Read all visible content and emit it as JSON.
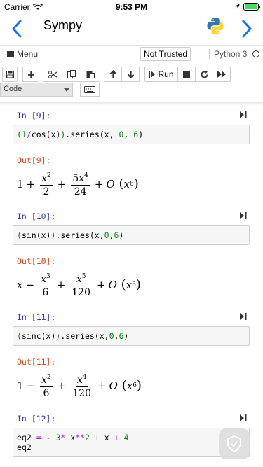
{
  "status": {
    "carrier": "Carrier",
    "time": "9:53 PM"
  },
  "nav": {
    "title": "Sympy"
  },
  "menubar": {
    "menu_label": "Menu",
    "trust": "Not Trusted",
    "kernel": "Python 3"
  },
  "toolbar": {
    "run_label": "Run",
    "cell_type": "Code"
  },
  "cells": [
    {
      "in_prompt": "In [9]:",
      "out_prompt": "Out[9]:"
    },
    {
      "in_prompt": "In [10]:",
      "out_prompt": "Out[10]:"
    },
    {
      "in_prompt": "In [11]:",
      "out_prompt": "Out[11]:"
    },
    {
      "in_prompt": "In [12]:"
    }
  ],
  "code": {
    "c9_a": "(",
    "c9_b": "1",
    "c9_c": "/",
    "c9_d": "cos(x)",
    "c9_e": ")",
    "c9_f": ".series(x, ",
    "c9_g": "0",
    "c9_h": ", ",
    "c9_i": "6",
    "c9_j": ")",
    "c10_a": "(",
    "c10_b": "sin(x)",
    "c10_c": ")",
    "c10_d": ".series(x,",
    "c10_e": "0",
    "c10_f": ",",
    "c10_g": "6",
    "c10_h": ")",
    "c11_a": "(",
    "c11_b": "sinc(x)",
    "c11_c": ")",
    "c11_d": ".series(x,",
    "c11_e": "0",
    "c11_f": ",",
    "c11_g": "6",
    "c11_h": ")",
    "c12_l1a": "eq2 ",
    "c12_l1b": "=",
    "c12_l1c": " ",
    "c12_l1d": "-",
    "c12_l1e": " ",
    "c12_l1f": "3",
    "c12_l1g": "*",
    "c12_l1h": " x",
    "c12_l1i": "**",
    "c12_l1j": "2",
    "c12_l1k": " ",
    "c12_l1l": "+",
    "c12_l1m": " x ",
    "c12_l1n": "+",
    "c12_l1o": " ",
    "c12_l1p": "4",
    "c12_l2": "eq2"
  },
  "out": {
    "o9": {
      "one": "1",
      "plus1": "+",
      "n1": "x",
      "n1e": "2",
      "d1": "2",
      "plus2": "+",
      "n2a": "5",
      "n2": "x",
      "n2e": "4",
      "d2": "24",
      "plus3": "+",
      "O": "O",
      "x": "x",
      "xe": "6"
    },
    "o10": {
      "x0": "x",
      "minus": "−",
      "n1": "x",
      "n1e": "3",
      "d1": "6",
      "plus2": "+",
      "n2": "x",
      "n2e": "5",
      "d2": "120",
      "plus3": "+",
      "O": "O",
      "x": "x",
      "xe": "6"
    },
    "o11": {
      "one": "1",
      "minus": "−",
      "n1": "x",
      "n1e": "2",
      "d1": "6",
      "plus2": "+",
      "n2": "x",
      "n2e": "4",
      "d2": "120",
      "plus3": "+",
      "O": "O",
      "x": "x",
      "xe": "6"
    }
  },
  "colors": {
    "accent": "#1a73e8",
    "in_prompt": "#303f9f",
    "out_prompt": "#d84315"
  }
}
